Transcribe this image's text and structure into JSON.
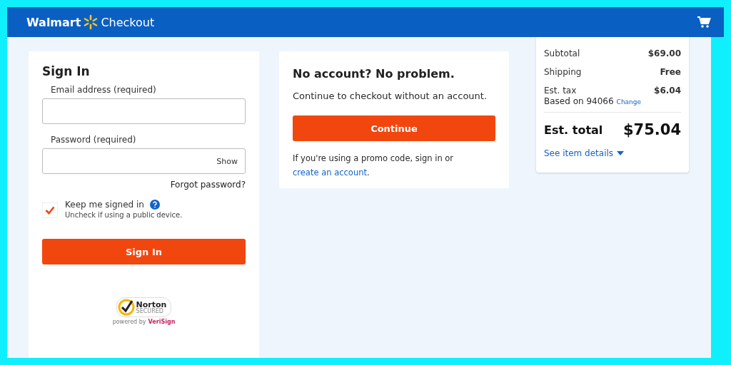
{
  "header": {
    "brand": "Walmart",
    "title": "Checkout"
  },
  "sign_in": {
    "heading": "Sign In",
    "email_label": "Email address (required)",
    "password_label": "Password (required)",
    "show_button": "Show",
    "forgot_link": "Forgot password?",
    "keep_signed_in": {
      "label": "Keep me signed in",
      "hint": "Uncheck if using a public device.",
      "checked": true
    },
    "submit": "Sign In",
    "badge": {
      "name": "Norton",
      "sub": "SECURED",
      "powered": "powered by",
      "vendor": "VeriSign"
    }
  },
  "guest": {
    "heading": "No account? No problem.",
    "text": "Continue to checkout without an account.",
    "button": "Continue",
    "promo_text": "If you're using a promo code, sign in or",
    "promo_link": "create an account",
    "promo_end": "."
  },
  "summary": {
    "rows": [
      {
        "label": "Subtotal",
        "value": "$69.00"
      },
      {
        "label": "Shipping",
        "value": "Free"
      },
      {
        "label": "Est. tax",
        "value": "$6.04"
      }
    ],
    "tax_note": "Based on 94066",
    "change_link": "Change",
    "total_label": "Est. total",
    "total_value": "$75.04",
    "details_link": "See item details"
  }
}
